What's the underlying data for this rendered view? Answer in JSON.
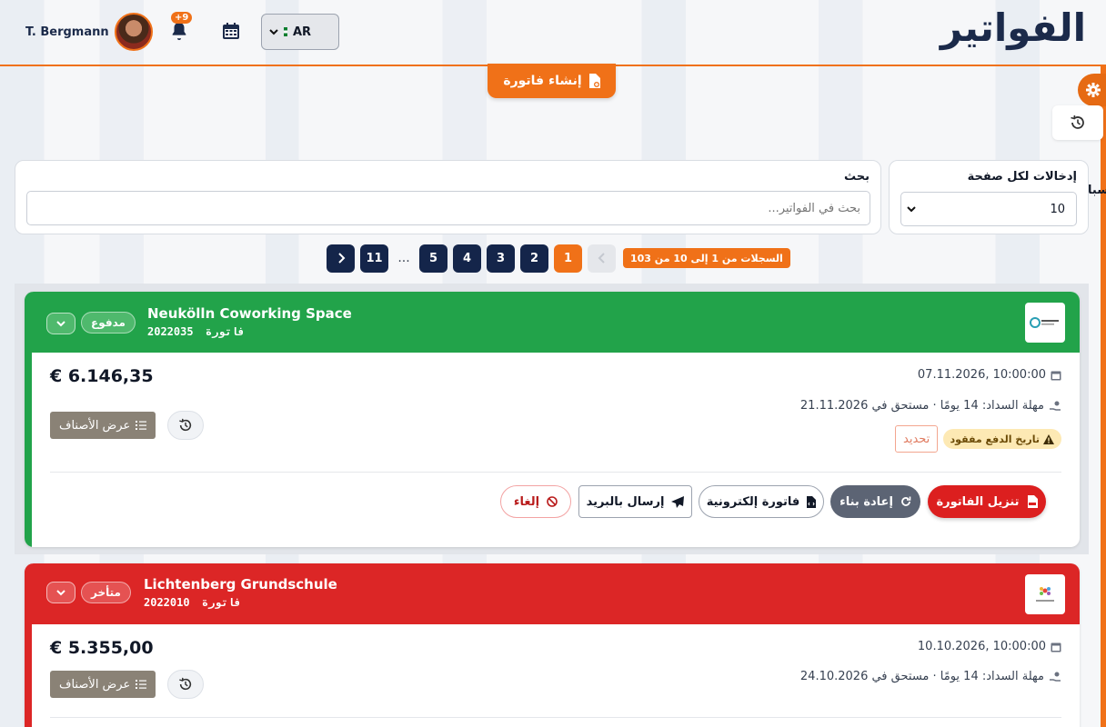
{
  "header": {
    "title": "الفواتير",
    "user_name": "T. Bergmann",
    "notification_badge": "+9",
    "language": "AR"
  },
  "toolbar": {
    "create_label": "إنشاء فاتورة",
    "cutoff_text": "سبا"
  },
  "filters": {
    "search_label": "بحث",
    "search_placeholder": "بحث في الفواتير...",
    "per_page_label": "إدخالات لكل صفحة",
    "per_page_value": "10"
  },
  "pagination": {
    "records_text": "السجلات من 1 إلى 10 من 103",
    "pages": [
      "1",
      "2",
      "3",
      "4",
      "5"
    ],
    "ellipsis": "...",
    "last_page": "11",
    "current": "1"
  },
  "colors": {
    "accent": "#f07118",
    "navy": "#14254a",
    "paid": "#22a34a",
    "overdue": "#dc2626"
  },
  "invoices": [
    {
      "client": "Neukölln Coworking Space",
      "invoice_label": "فاتورة",
      "invoice_number": "2022035",
      "status": "مدفوع",
      "amount": "€ 6.146,35",
      "date": "10:00:00 ,07.11.2026",
      "due_text": "مهلة السداد: 14 يومًا · مستحق في 21.11.2026",
      "warning": "تاريخ الدفع مفقود",
      "update_label": "تحديد",
      "items_label": "عرض الأصناف",
      "actions": {
        "download": "تنزيل الفاتورة",
        "rebuild": "إعادة بناء",
        "einvoice": "فاتورة إلكترونية",
        "email": "إرسال بالبريد",
        "cancel": "إلغاء"
      }
    },
    {
      "client": "Lichtenberg Grundschule",
      "invoice_label": "فاتورة",
      "invoice_number": "2022010",
      "status": "متأخر",
      "amount": "€ 5.355,00",
      "date": "10:00:00 ,10.10.2026",
      "due_text": "مهلة السداد: 14 يومًا · مستحق في 24.10.2026",
      "items_label": "عرض الأصناف"
    }
  ]
}
